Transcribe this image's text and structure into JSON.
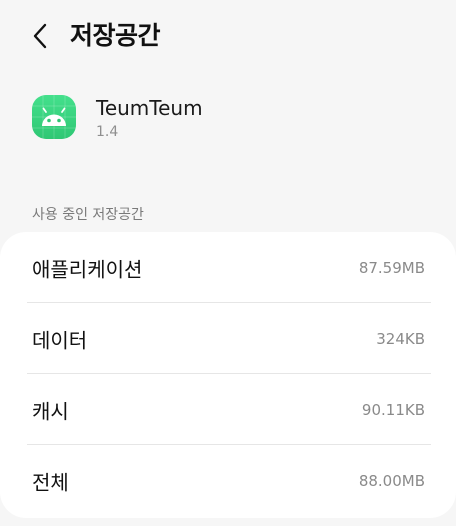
{
  "header": {
    "title": "저장공간",
    "back_icon": "chevron-left-icon"
  },
  "app": {
    "name": "TeumTeum",
    "version": "1.4",
    "icon": "android-icon",
    "icon_color": "#3ddc84"
  },
  "storage": {
    "section_label": "사용 중인 저장공간",
    "items": [
      {
        "label": "애플리케이션",
        "value": "87.59MB"
      },
      {
        "label": "데이터",
        "value": "324KB"
      },
      {
        "label": "캐시",
        "value": "90.11KB"
      },
      {
        "label": "전체",
        "value": "88.00MB"
      }
    ]
  }
}
